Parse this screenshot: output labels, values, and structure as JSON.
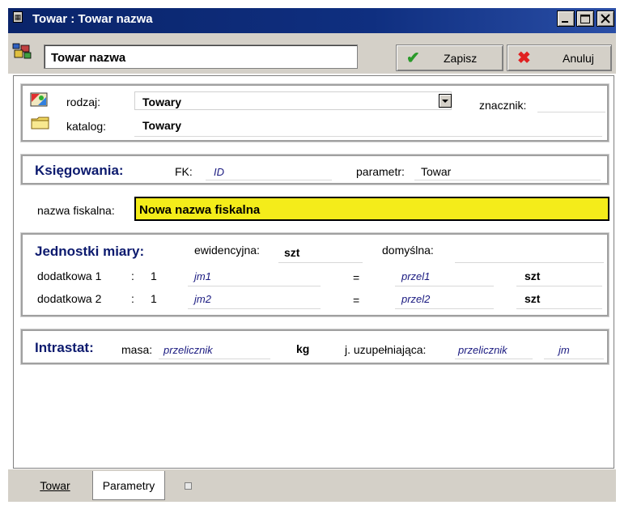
{
  "window": {
    "title": "Towar : Towar nazwa"
  },
  "toolbar": {
    "name_value": "Towar nazwa",
    "save_label": "Zapisz",
    "cancel_label": "Anuluj"
  },
  "category_group": {
    "rodzaj_label": "rodzaj:",
    "rodzaj_value": "Towary",
    "katalog_label": "katalog:",
    "katalog_value": "Towary",
    "znacznik_label": "znacznik:"
  },
  "accounting_group": {
    "heading": "Księgowania:",
    "fk_label": "FK:",
    "fk_value": "ID",
    "parametr_label": "parametr:",
    "parametr_value": "Towar"
  },
  "fiscal": {
    "label": "nazwa fiskalna:",
    "value": "Nowa nazwa fiskalna"
  },
  "units_group": {
    "heading": "Jednostki miary:",
    "ewidencyjna_label": "ewidencyjna:",
    "ewidencyjna_value": "szt",
    "domyslna_label": "domyślna:",
    "rows": [
      {
        "label": "dodatkowa 1",
        "sep": ":",
        "qty": "1",
        "unit": "jm1",
        "eq": "=",
        "factor": "przel1",
        "base": "szt"
      },
      {
        "label": "dodatkowa 2",
        "sep": ":",
        "qty": "1",
        "unit": "jm2",
        "eq": "=",
        "factor": "przel2",
        "base": "szt"
      }
    ]
  },
  "intrastat_group": {
    "heading": "Intrastat:",
    "masa_label": "masa:",
    "masa_value": "przelicznik",
    "masa_unit": "kg",
    "supp_label": "j. uzupełniająca:",
    "supp_value": "przelicznik",
    "supp_unit": "jm"
  },
  "tabs": [
    {
      "label": "Towar",
      "active": false
    },
    {
      "label": "Parametry",
      "active": true
    }
  ]
}
